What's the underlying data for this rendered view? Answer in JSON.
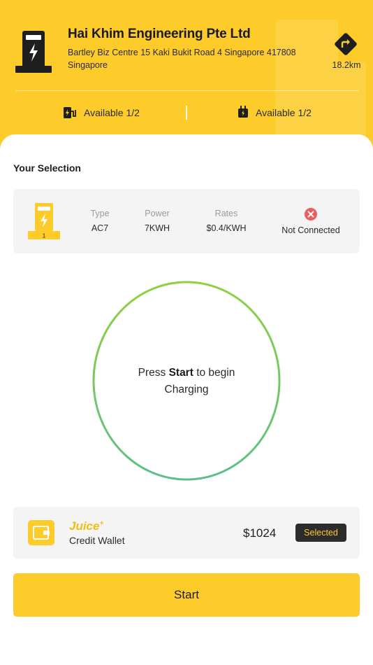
{
  "station": {
    "name": "Hai Khim Engineering Pte Ltd",
    "address": "Bartley Biz Centre 15 Kaki Bukit Road 4 Singapore 417808 Singapore",
    "distance": "18.2km"
  },
  "availability": {
    "left_label": "Available 1/2",
    "right_label": "Available 1/2"
  },
  "selection": {
    "title": "Your Selection",
    "charger_number": "1",
    "type_label": "Type",
    "type_value": "AC7",
    "power_label": "Power",
    "power_value": "7KWH",
    "rates_label": "Rates",
    "rates_value": "$0.4/KWH",
    "status": "Not Connected"
  },
  "charging": {
    "prefix": "Press ",
    "emphasis": "Start",
    "suffix": " to begin Charging"
  },
  "wallet": {
    "brand": "Juice",
    "brand_sup": "+",
    "label": "Credit Wallet",
    "balance": "$1024",
    "badge": "Selected"
  },
  "actions": {
    "start_label": "Start"
  },
  "colors": {
    "brand_yellow": "#fdcb2a",
    "ring_start": "#8fd13f",
    "ring_end": "#5dbf87",
    "error_red": "#ee5b5b",
    "badge_dark": "#2c2c2c"
  },
  "icons": {
    "station": "ev-station-icon",
    "navigate": "turn-right-arrow-icon",
    "available_left": "charger-plug-icon",
    "available_right": "plug-icon",
    "charger": "ev-charger-icon",
    "status": "close-circle-icon",
    "wallet": "wallet-icon"
  }
}
